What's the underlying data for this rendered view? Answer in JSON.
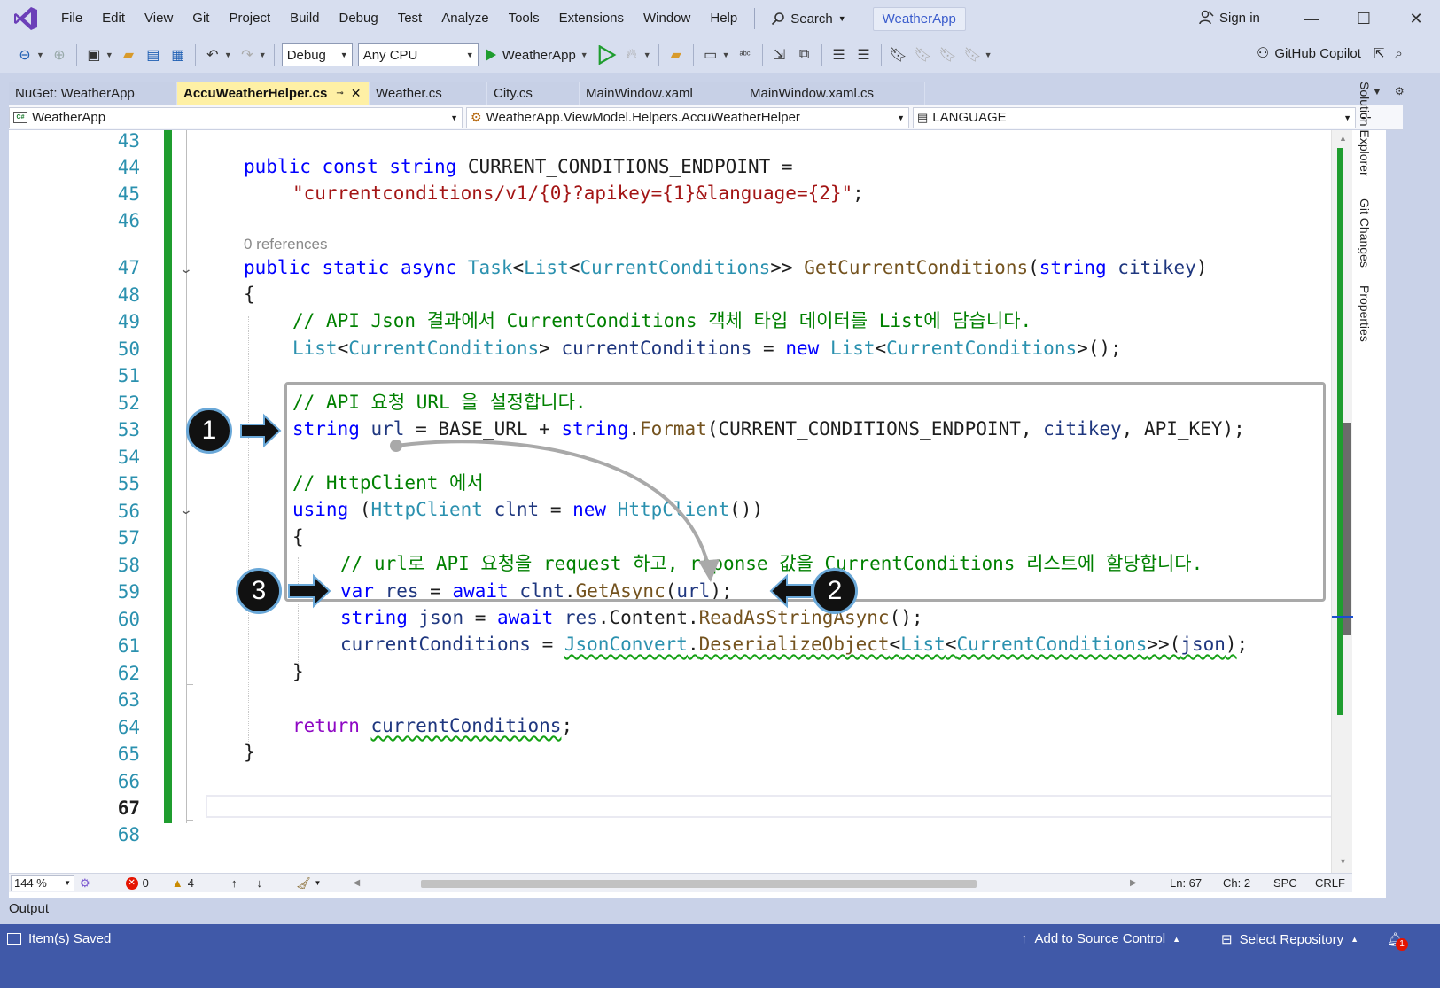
{
  "menu": [
    "File",
    "Edit",
    "View",
    "Git",
    "Project",
    "Build",
    "Debug",
    "Test",
    "Analyze",
    "Tools",
    "Extensions",
    "Window",
    "Help"
  ],
  "search_label": "Search",
  "app_title": "WeatherApp",
  "sign_in": "Sign in",
  "toolbar": {
    "config": "Debug",
    "platform": "Any CPU",
    "run_target": "WeatherApp",
    "copilot": "GitHub Copilot"
  },
  "tabs": [
    {
      "label": "NuGet: WeatherApp"
    },
    {
      "label": "AccuWeatherHelper.cs",
      "active": true
    },
    {
      "label": "Weather.cs"
    },
    {
      "label": "City.cs"
    },
    {
      "label": "MainWindow.xaml"
    },
    {
      "label": "MainWindow.xaml.cs"
    }
  ],
  "nav": {
    "project": "WeatherApp",
    "type": "WeatherApp.ViewModel.Helpers.AccuWeatherHelper",
    "member": "LANGUAGE"
  },
  "side_panels": [
    "Solution Explorer",
    "Git Changes",
    "Properties"
  ],
  "code": {
    "line_numbers": [
      "43",
      "44",
      "45",
      "46",
      "47",
      "48",
      "49",
      "50",
      "51",
      "52",
      "53",
      "54",
      "55",
      "56",
      "57",
      "58",
      "59",
      "60",
      "61",
      "62",
      "63",
      "64",
      "65",
      "66",
      "67",
      "68"
    ],
    "references": "0 references",
    "lines": {
      "l44": "public const string CURRENT_CONDITIONS_ENDPOINT =",
      "l45": "\"currentconditions/v1/{0}?apikey={1}&language={2}\";",
      "l47": "public static async Task<List<CurrentConditions>> GetCurrentConditions(string citikey)",
      "l48": "{",
      "l49": "// API Json 결과에서 CurrentConditions 객체 타입 데이터를 List에 담습니다.",
      "l50": "List<CurrentConditions> currentConditions = new List<CurrentConditions>();",
      "l52": "// API 요청 URL 을 설정합니다.",
      "l53": "string url = BASE_URL + string.Format(CURRENT_CONDITIONS_ENDPOINT, citikey, API_KEY);",
      "l55": "// HttpClient 에서",
      "l56": "using (HttpClient clnt = new HttpClient())",
      "l57": "{",
      "l58": "// url로 API 요청을 request 하고, reponse 값을 CurrentConditions 리스트에 할당합니다.",
      "l59": "var res = await clnt.GetAsync(url);",
      "l60": "string json = await res.Content.ReadAsStringAsync();",
      "l61": "currentConditions = JsonConvert.DeserializeObject<List<CurrentConditions>>(json);",
      "l62": "}",
      "l64": "return currentConditions;",
      "l65": "}"
    }
  },
  "annotations": [
    "1",
    "2",
    "3"
  ],
  "editor_status": {
    "zoom": "144 %",
    "errors": "0",
    "warnings": "4",
    "ln": "Ln: 67",
    "ch": "Ch: 2",
    "spc": "SPC",
    "crlf": "CRLF"
  },
  "output_label": "Output",
  "statusbar": {
    "saved": "Item(s) Saved",
    "source_control": "Add to Source Control",
    "repository": "Select Repository",
    "notifications": "1"
  },
  "colors": {
    "accent": "#4059a8",
    "active_tab": "#fef0a5",
    "change_bar": "#1f9d2f",
    "keyword": "#0000ff",
    "type": "#2b91af",
    "comment": "#008000",
    "string": "#a31515"
  }
}
